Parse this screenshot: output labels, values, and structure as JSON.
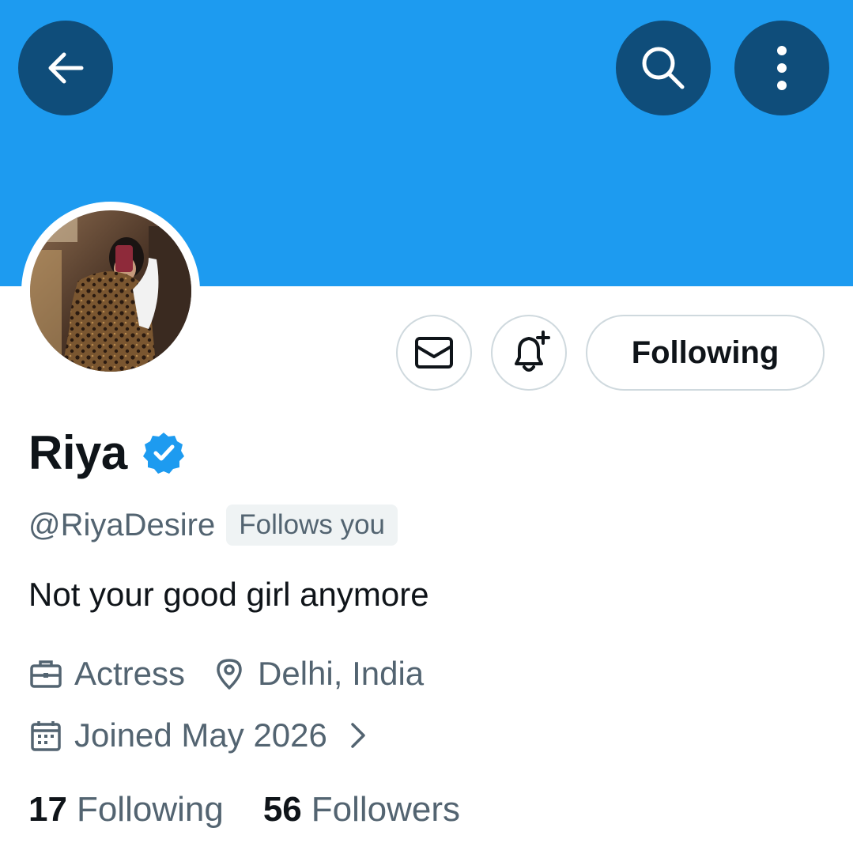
{
  "header": {
    "back_icon": "arrow-left-icon",
    "search_icon": "search-icon",
    "more_icon": "more-vertical-icon",
    "banner_color": "#1d9bf0",
    "button_color": "#0f4d7a"
  },
  "actions": {
    "message_icon": "envelope-icon",
    "notify_icon": "bell-plus-icon",
    "follow_label": "Following"
  },
  "profile": {
    "name": "Riya",
    "verified_icon": "verified-badge-icon",
    "handle": "@RiyaDesire",
    "follows_you": "Follows you",
    "bio": "Not your good girl anymore",
    "profession": "Actress",
    "location": "Delhi, India",
    "joined": "Joined May 2026"
  },
  "stats": {
    "following_count": "17",
    "following_label": "Following",
    "followers_count": "56",
    "followers_label": "Followers"
  },
  "colors": {
    "accent": "#1d9bf0",
    "text_primary": "#0f1419",
    "text_secondary": "#536471",
    "border": "#cfd9de"
  }
}
